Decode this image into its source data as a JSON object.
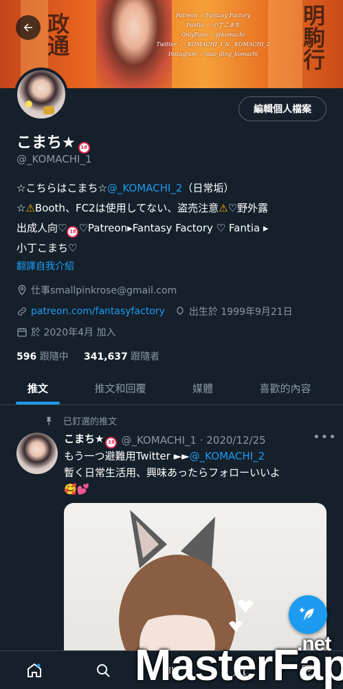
{
  "banner": {
    "credits": [
      "Patreon ☆ Fantasy Factory",
      "Fantia ☆ 小丁こまち",
      "OnlyFans ☆ @komachi",
      "Twitter ☆ _KOMACHI_1 & _KOMACHI_2",
      "Instagram ☆ siao_ding_komachi"
    ],
    "kanji_left": "政通",
    "kanji_right": "明駒行"
  },
  "profile": {
    "name": "こまち★",
    "handle": "@_KOMACHI_1",
    "edit_button": "編輯個人檔案",
    "bio": {
      "line1_a": "☆こちらはこまち☆",
      "line1_link": "@_KOMACHI_2",
      "line1_b": "（日常垢）",
      "line2_a": "☆",
      "line2_b": "Booth、FC2は使用してない、盗売注意",
      "line2_c": "♡野外露",
      "line3_a": "出成人向♡",
      "line3_b": "♡Patreon▸Fantasy Factory ♡ Fantia ▸",
      "line4": "小丁こまち♡"
    },
    "r18_badge": "18",
    "translate": "翻譯自我介紹",
    "job": "仕事smallpinkrose@gmail.com",
    "website": "patreon.com/fantasyfactory",
    "birthday": "出生於 1999年9月21日",
    "joined": "於 2020年4月 加入",
    "following_count": "596",
    "following_label": "跟隨中",
    "followers_count": "341,637",
    "followers_label": "跟隨者"
  },
  "tabs": [
    {
      "label": "推文",
      "active": true
    },
    {
      "label": "推文和回覆",
      "active": false
    },
    {
      "label": "媒體",
      "active": false
    },
    {
      "label": "喜歡的內容",
      "active": false
    }
  ],
  "tweet": {
    "pinned_label": "已釘選的推文",
    "name": "こまち★",
    "handle_date": "@_KOMACHI_1 · 2020/12/25",
    "more": "•••",
    "text_a": "もう一つ避難用Twitter ►►",
    "text_link": "@_KOMACHI_2",
    "text_b": "暫く日常生活用、興味あったらフォローいいよ",
    "emoji": "🥰💕"
  },
  "watermark": {
    "text": "MasterFap",
    "tld": ".net"
  },
  "colors": {
    "background": "#15202b",
    "accent": "#1d9bf0",
    "muted": "#8b98a5",
    "divider": "#38444d"
  }
}
